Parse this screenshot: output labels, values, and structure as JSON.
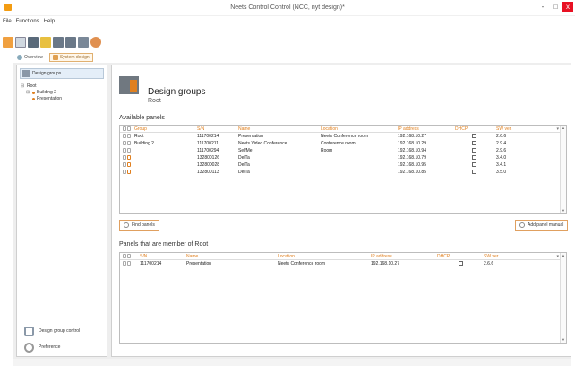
{
  "window": {
    "title": "Neets Control Control (NCC, nyt design)*",
    "minimize": "-",
    "maximize": "□",
    "close": "x"
  },
  "menu": [
    "File",
    "Functions",
    "Help"
  ],
  "tabs": [
    {
      "label": "Overview"
    },
    {
      "label": "System design"
    }
  ],
  "sidebar": {
    "header": "Design groups",
    "tree": {
      "root": "Root",
      "children": [
        "Building 2",
        "Presentation"
      ]
    },
    "footer": [
      "Design group control",
      "Preference"
    ]
  },
  "header": {
    "title": "Design groups",
    "subtitle": "Root"
  },
  "available": {
    "title": "Available panels",
    "columns": [
      "Group",
      "S/N",
      "Name",
      "Location",
      "IP address",
      "DHCP",
      "SW ver."
    ],
    "rows": [
      {
        "group": "Root",
        "sn": "111700214",
        "name": "Presentation",
        "location": "Neets Conference room",
        "ip": "192.168.10.27",
        "ver": "2.6.6"
      },
      {
        "group": "Building 2",
        "sn": "111700211",
        "name": "Neets Video Conference",
        "location": "Conference room",
        "ip": "192.168.10.29",
        "ver": "2.9.4"
      },
      {
        "group": "",
        "sn": "111700294",
        "name": "SelfMe",
        "location": "Room",
        "ip": "192.168.10.94",
        "ver": "2.9.6"
      },
      {
        "group": "",
        "sn": "132800126",
        "name": "DelTa",
        "location": "",
        "ip": "192.168.10.79",
        "ver": "3.4.0"
      },
      {
        "group": "",
        "sn": "132800028",
        "name": "DelTa",
        "location": "",
        "ip": "192.168.10.95",
        "ver": "3.4.1"
      },
      {
        "group": "",
        "sn": "132800113",
        "name": "DelTa",
        "location": "",
        "ip": "192.168.10.85",
        "ver": "3.5.0"
      }
    ],
    "find_button": "Find panels",
    "add_button": "Add panel manual"
  },
  "members": {
    "title": "Panels that are member of Root",
    "columns": [
      "S/N",
      "Name",
      "Location",
      "IP address",
      "DHCP",
      "SW ver."
    ],
    "rows": [
      {
        "sn": "111700214",
        "name": "Presentation",
        "location": "Neets Conference room",
        "ip": "192.168.10.27",
        "ver": "2.6.6"
      }
    ]
  }
}
